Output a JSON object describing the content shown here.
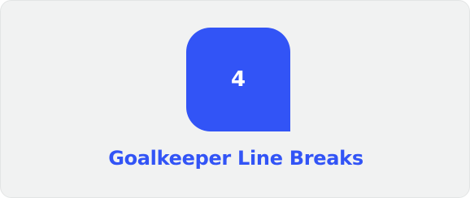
{
  "stat": {
    "value": "4",
    "label": "Goalkeeper Line Breaks"
  },
  "colors": {
    "accent": "#3254f6",
    "card_background": "#f1f2f2",
    "value_text": "#ffffff"
  }
}
